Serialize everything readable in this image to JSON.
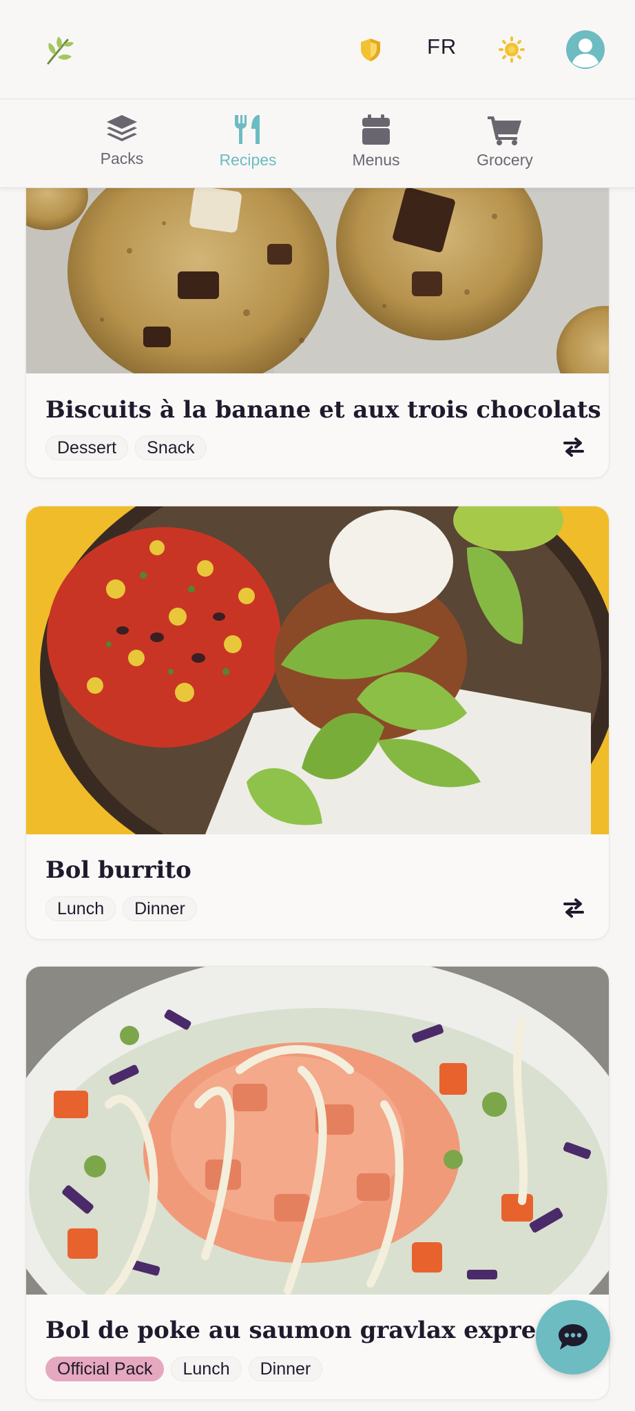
{
  "header": {
    "logo_icon": "sprout-icon",
    "shield_icon": "shield-icon",
    "language": "FR",
    "theme_icon": "sun-icon",
    "avatar_icon": "user-avatar-icon"
  },
  "nav": {
    "items": [
      {
        "label": "Packs",
        "icon": "layers-icon"
      },
      {
        "label": "Recipes",
        "icon": "utensils-icon",
        "active": true
      },
      {
        "label": "Menus",
        "icon": "calendar-icon"
      },
      {
        "label": "Grocery",
        "icon": "cart-icon"
      }
    ]
  },
  "recipes": [
    {
      "title": "Biscuits à la banane et aux trois chocolats",
      "tags": [
        "Dessert",
        "Snack"
      ],
      "image": "banana-chocolate-cookies-photo",
      "action_icon": "swap-icon"
    },
    {
      "title": "Bol burrito",
      "tags": [
        "Lunch",
        "Dinner"
      ],
      "image": "burrito-bowl-photo",
      "action_icon": "swap-icon"
    },
    {
      "title": "Bol de poke au saumon gravlax express",
      "tags": [
        "Official Pack",
        "Lunch",
        "Dinner"
      ],
      "image": "salmon-poke-bowl-photo"
    }
  ],
  "chat_icon": "chat-bubble-icon",
  "colors": {
    "accent": "#6cbcc2",
    "official_tag": "#e6a8be",
    "text": "#1f1b2d",
    "shield": "#f2c232"
  }
}
